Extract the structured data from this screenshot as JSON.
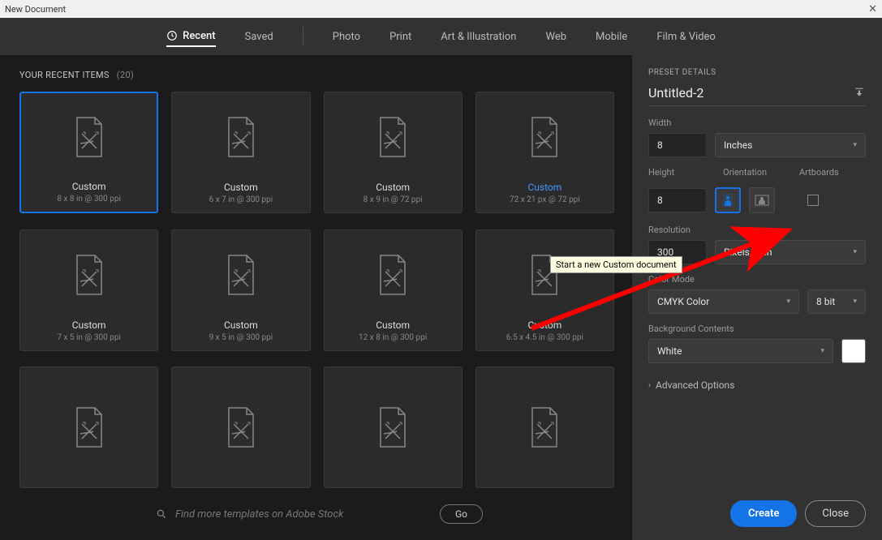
{
  "window": {
    "title": "New Document"
  },
  "tabs": {
    "recent": "Recent",
    "saved": "Saved",
    "photo": "Photo",
    "print": "Print",
    "art": "Art & Illustration",
    "web": "Web",
    "mobile": "Mobile",
    "film": "Film & Video"
  },
  "recent": {
    "heading": "YOUR RECENT ITEMS",
    "count": "(20)",
    "items": [
      {
        "name": "Custom",
        "sub": "8 x 8 in @ 300 ppi",
        "selected": true,
        "highlight": false
      },
      {
        "name": "Custom",
        "sub": "6 x 7 in @ 300 ppi",
        "selected": false,
        "highlight": false
      },
      {
        "name": "Custom",
        "sub": "8 x 9 in @ 72 ppi",
        "selected": false,
        "highlight": false
      },
      {
        "name": "Custom",
        "sub": "72 x 21 px @ 72 ppi",
        "selected": false,
        "highlight": true
      },
      {
        "name": "Custom",
        "sub": "7 x 5 in @ 300 ppi",
        "selected": false,
        "highlight": false
      },
      {
        "name": "Custom",
        "sub": "9 x 5 in @ 300 ppi",
        "selected": false,
        "highlight": false
      },
      {
        "name": "Custom",
        "sub": "12 x 8 in @ 300 ppi",
        "selected": false,
        "highlight": false
      },
      {
        "name": "Custom",
        "sub": "6.5 x 4.5 in @ 300 ppi",
        "selected": false,
        "highlight": false
      },
      {
        "name": "",
        "sub": "",
        "selected": false,
        "highlight": false
      },
      {
        "name": "",
        "sub": "",
        "selected": false,
        "highlight": false
      },
      {
        "name": "",
        "sub": "",
        "selected": false,
        "highlight": false
      },
      {
        "name": "",
        "sub": "",
        "selected": false,
        "highlight": false
      }
    ]
  },
  "search": {
    "placeholder": "Find more templates on Adobe Stock",
    "go": "Go"
  },
  "details": {
    "heading": "PRESET DETAILS",
    "docname": "Untitled-2",
    "width_label": "Width",
    "width_value": "8",
    "units": "Inches",
    "height_label": "Height",
    "height_value": "8",
    "orientation_label": "Orientation",
    "artboards_label": "Artboards",
    "resolution_label": "Resolution",
    "resolution_value": "300",
    "resolution_units": "Pixels/Inch",
    "colormode_label": "Color Mode",
    "colormode_value": "CMYK Color",
    "bitdepth": "8 bit",
    "bg_label": "Background Contents",
    "bg_value": "White",
    "advanced": "Advanced Options",
    "create": "Create",
    "close": "Close"
  },
  "tooltip": {
    "text": "Start a new Custom document"
  }
}
